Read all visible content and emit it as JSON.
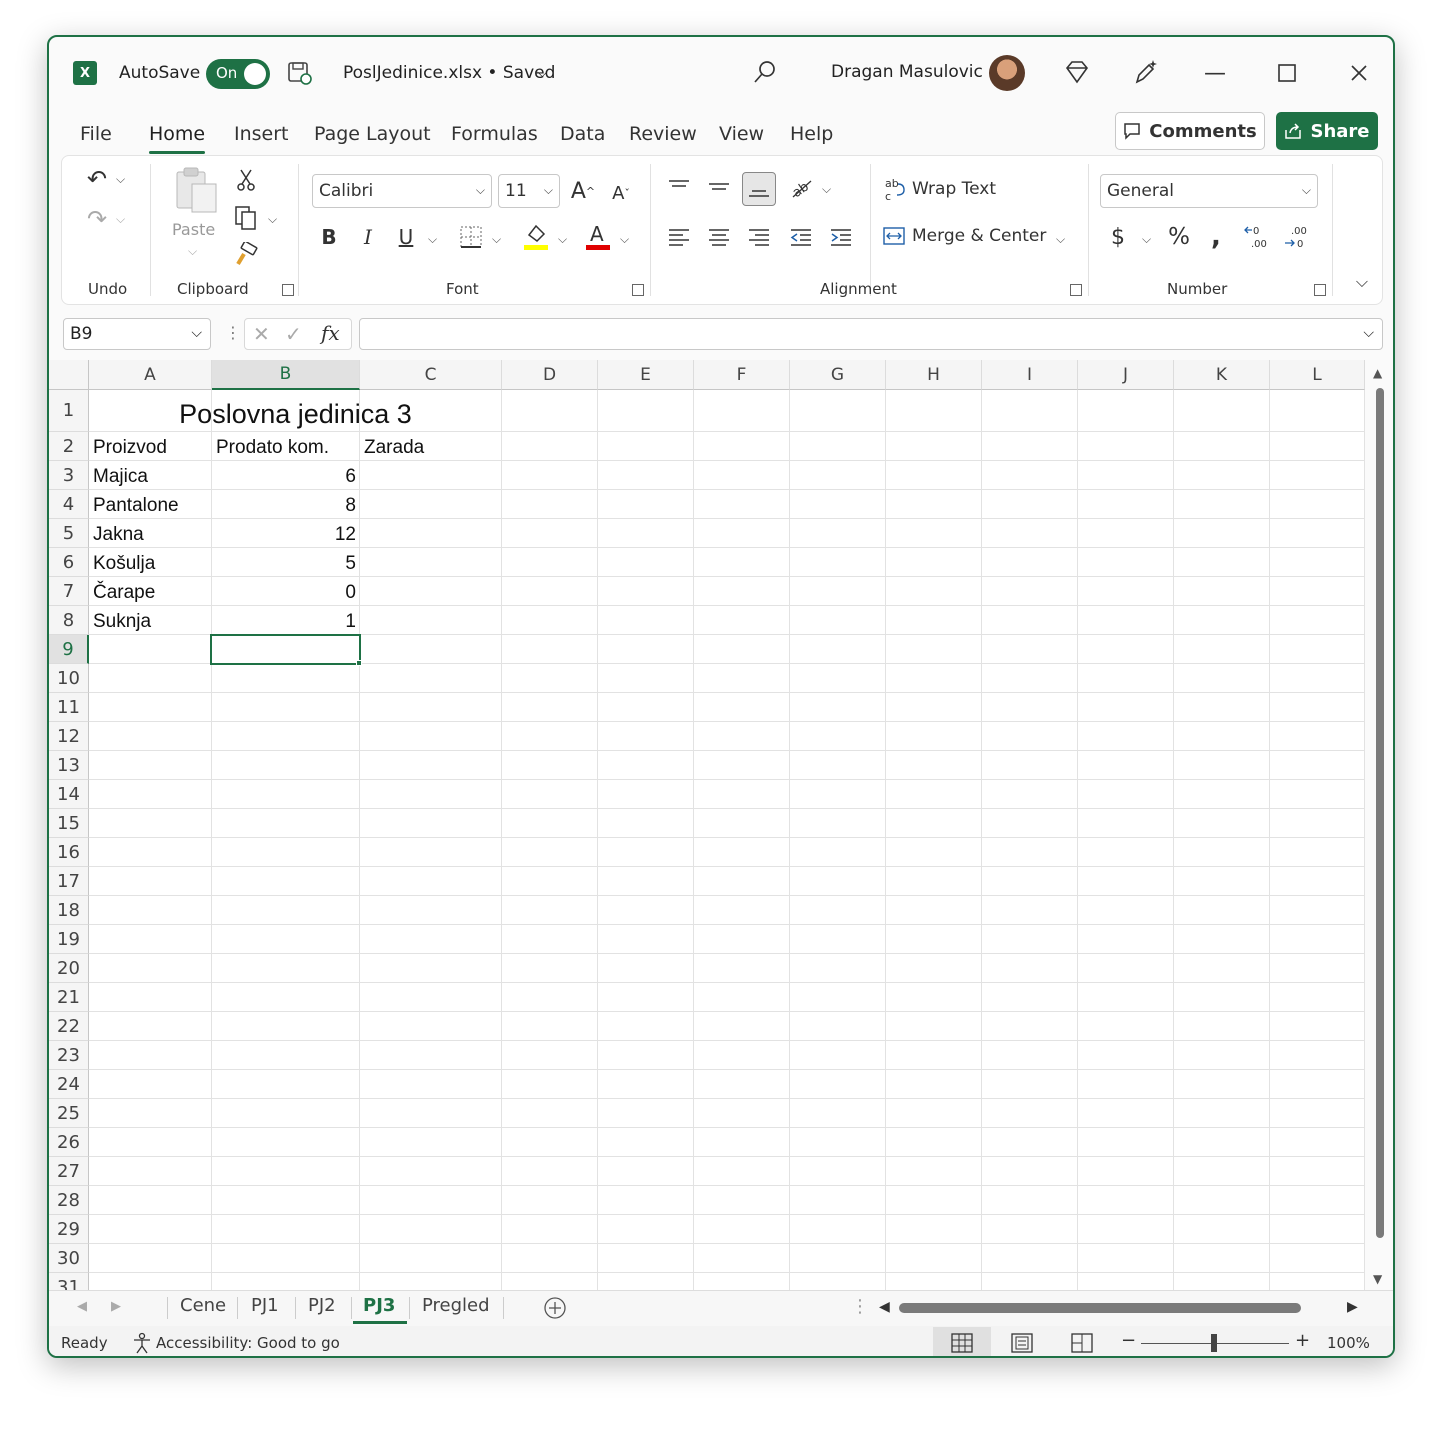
{
  "titlebar": {
    "autosave_label": "AutoSave",
    "toggle_label": "On",
    "filename": "PoslJedinice.xlsx • Saved",
    "user": "Dragan Masulovic"
  },
  "menu": [
    "File",
    "Home",
    "Insert",
    "Page Layout",
    "Formulas",
    "Data",
    "Review",
    "View",
    "Help"
  ],
  "buttons": {
    "comments": "Comments",
    "share": "Share"
  },
  "ribbon": {
    "paste": "Paste",
    "font_name": "Calibri",
    "font_size": "11",
    "wrap_text": "Wrap Text",
    "merge_center": "Merge & Center",
    "number_format": "General",
    "groups": {
      "undo": "Undo",
      "clipboard": "Clipboard",
      "font": "Font",
      "alignment": "Alignment",
      "number": "Number"
    }
  },
  "formula": {
    "namebox": "B9",
    "value": ""
  },
  "columns": [
    "A",
    "B",
    "C",
    "D",
    "E",
    "F",
    "G",
    "H",
    "I",
    "J",
    "K",
    "L"
  ],
  "rows": [
    "1",
    "2",
    "3",
    "4",
    "5",
    "6",
    "7",
    "8",
    "9",
    "10",
    "11",
    "12",
    "13",
    "14",
    "15",
    "16",
    "17",
    "18",
    "19",
    "20",
    "21",
    "22",
    "23",
    "24",
    "25",
    "26",
    "27",
    "28",
    "29",
    "30",
    "31"
  ],
  "sheet": {
    "title": "Poslovna jedinica 3",
    "headers": [
      "Proizvod",
      "Prodato kom.",
      "Zarada"
    ],
    "data": [
      {
        "product": "Majica",
        "qty": "6"
      },
      {
        "product": "Pantalone",
        "qty": "8"
      },
      {
        "product": "Jakna",
        "qty": "12"
      },
      {
        "product": "Košulja",
        "qty": "5"
      },
      {
        "product": "Čarape",
        "qty": "0"
      },
      {
        "product": "Suknja",
        "qty": "1"
      }
    ]
  },
  "tabs": [
    "Cene",
    "PJ1",
    "PJ2",
    "PJ3",
    "Pregled"
  ],
  "active_tab": "PJ3",
  "status": {
    "ready": "Ready",
    "accessibility": "Accessibility: Good to go",
    "zoom": "100%"
  },
  "colors": {
    "accent": "#1e7145"
  }
}
